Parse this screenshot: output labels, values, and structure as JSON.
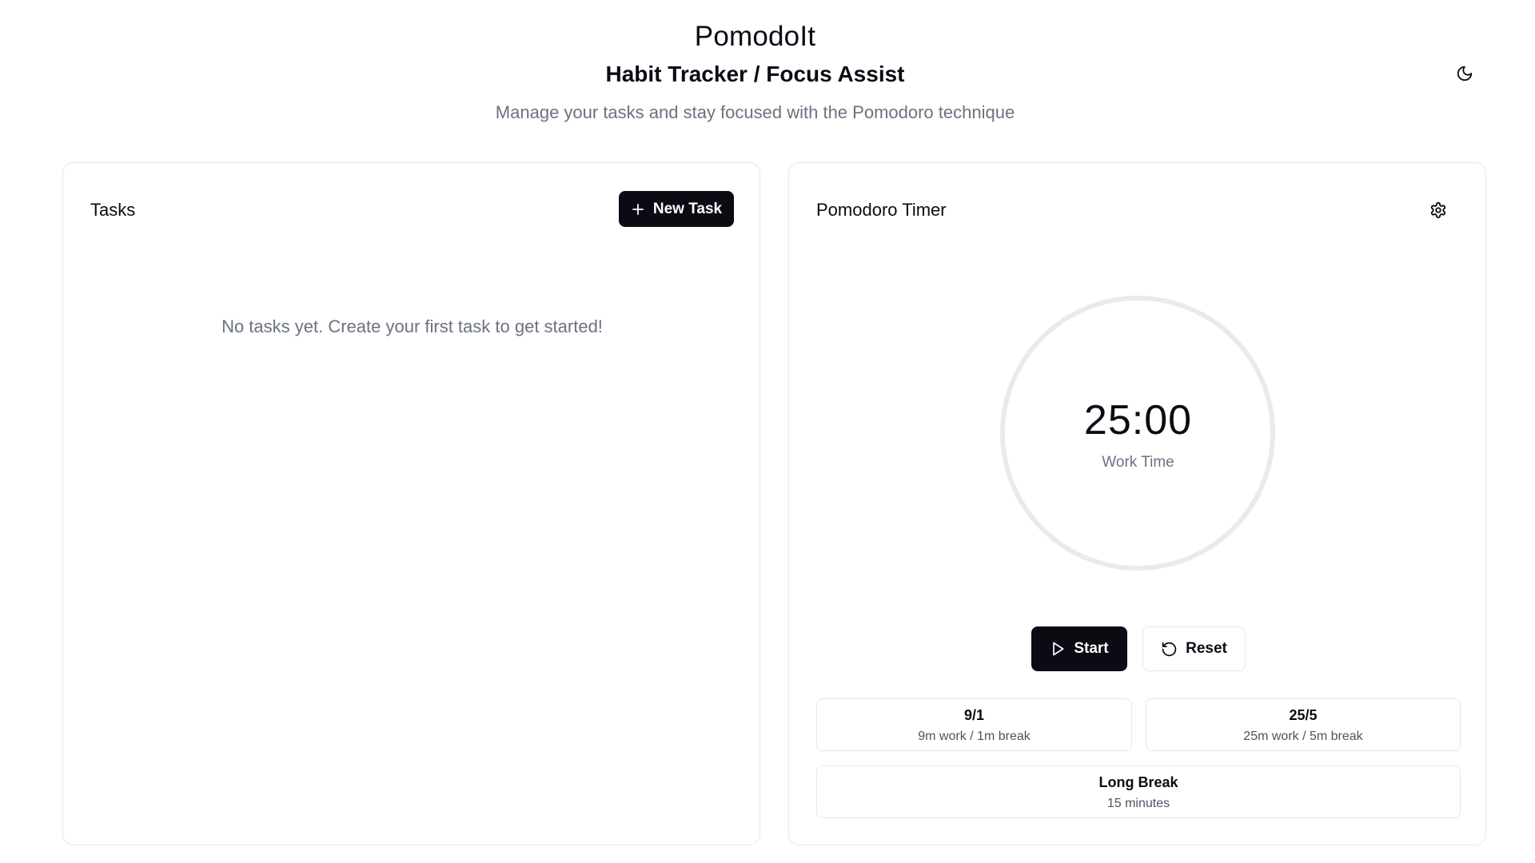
{
  "header": {
    "title": "PomodoIt",
    "subtitle": "Habit Tracker / Focus Assist",
    "tagline": "Manage your tasks and stay focused with the Pomodoro technique",
    "theme_icon": "moon-icon"
  },
  "tasks": {
    "title": "Tasks",
    "new_task_label": "New Task",
    "new_task_icon": "plus-icon",
    "empty_message": "No tasks yet. Create your first task to get started!"
  },
  "timer": {
    "title": "Pomodoro Timer",
    "settings_icon": "gear-icon",
    "time": "25:00",
    "mode": "Work Time",
    "progress": 0,
    "start_label": "Start",
    "start_icon": "play-icon",
    "reset_label": "Reset",
    "reset_icon": "rotate-ccw-icon",
    "presets": [
      {
        "title": "9/1",
        "subtitle": "9m work / 1m break"
      },
      {
        "title": "25/5",
        "subtitle": "25m work / 5m break"
      },
      {
        "title": "Long Break",
        "subtitle": "15 minutes"
      }
    ]
  },
  "colors": {
    "primary": "#0b0b14",
    "muted_text": "#6b7280",
    "border": "#e5e7eb",
    "ring_track": "#e9eaee"
  }
}
